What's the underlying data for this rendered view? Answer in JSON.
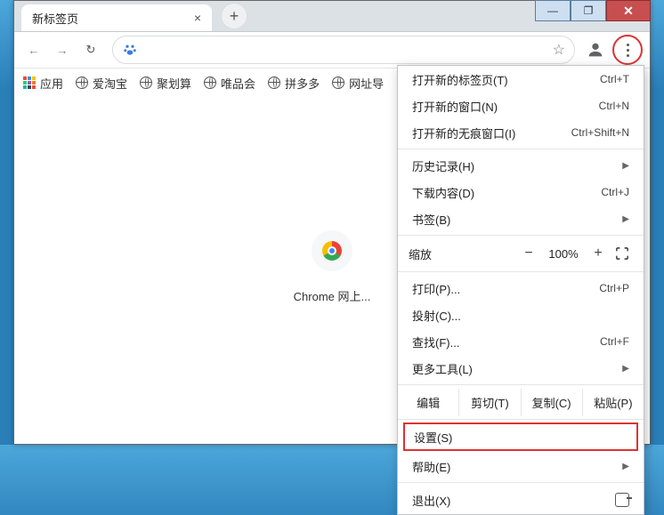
{
  "titlebar": {
    "min": "—",
    "max": "❐",
    "close": "✕"
  },
  "tab": {
    "title": "新标签页",
    "close": "×",
    "new": "+"
  },
  "omnibox": {
    "value": "",
    "placeholder": ""
  },
  "bookmarks": {
    "apps": "应用",
    "items": [
      "爱淘宝",
      "聚划算",
      "唯品会",
      "拼多多",
      "网址导"
    ]
  },
  "store": {
    "label": "Chrome 网上..."
  },
  "menu": {
    "newtab": {
      "l": "打开新的标签页(T)",
      "s": "Ctrl+T"
    },
    "newwin": {
      "l": "打开新的窗口(N)",
      "s": "Ctrl+N"
    },
    "incog": {
      "l": "打开新的无痕窗口(I)",
      "s": "Ctrl+Shift+N"
    },
    "history": {
      "l": "历史记录(H)"
    },
    "downloads": {
      "l": "下载内容(D)",
      "s": "Ctrl+J"
    },
    "bookmarks": {
      "l": "书签(B)"
    },
    "zoom": {
      "l": "缩放",
      "minus": "−",
      "val": "100%",
      "plus": "+"
    },
    "print": {
      "l": "打印(P)...",
      "s": "Ctrl+P"
    },
    "cast": {
      "l": "投射(C)..."
    },
    "find": {
      "l": "查找(F)...",
      "s": "Ctrl+F"
    },
    "moretools": {
      "l": "更多工具(L)"
    },
    "edit": {
      "l": "编辑",
      "cut": "剪切(T)",
      "copy": "复制(C)",
      "paste": "粘贴(P)"
    },
    "settings": {
      "l": "设置(S)"
    },
    "help": {
      "l": "帮助(E)"
    },
    "exit": {
      "l": "退出(X)"
    }
  }
}
